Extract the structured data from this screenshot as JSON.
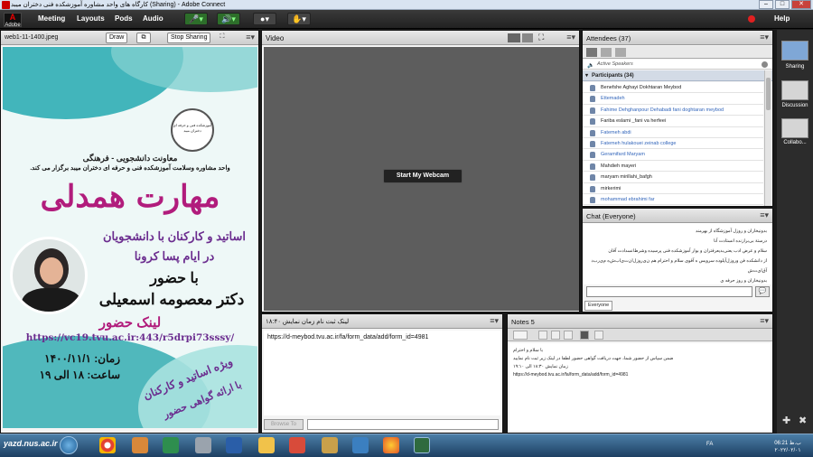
{
  "window_title": "کارگاه های  واحد مشاوره آموزشکده فنی دختران میبد (Sharing) - Adobe Connect",
  "app_logo_text": "Adobe",
  "menu": [
    "Meeting",
    "Layouts",
    "Pods",
    "Audio"
  ],
  "help_label": "Help",
  "share_pod": {
    "title": "web1-11-1400.jpeg",
    "draw_label": "Draw",
    "stop_label": "Stop Sharing",
    "poster": {
      "dept": "معاونت دانشجویی - فرهنگی",
      "org": "واحد مشاوره وسلامت آموزشکده فنی و حرفه ای دختران میبد برگزار می کند.",
      "main_title": "مهارت همدلی",
      "sub1": "اساتید و کارکنان با دانشجویان",
      "sub2": "در ایام پسا کرونا",
      "with": "با حضور",
      "speaker": "دکتر معصومه اسمعیلی",
      "link_title": "لینک حضور",
      "url": "https://vc19.tvu.ac.ir:443/r5drpi73sssy/",
      "date": "زمان: ۱۴۰۰/۱۱/۱",
      "time": "ساعت: ۱۸ الی ۱۹",
      "ribbon1": "ویژه اساتید و کارکنان",
      "ribbon2": "با ارائه گواهی حضور",
      "logo_text": "آموزشکده فنی و حرفه ای دختران میبد"
    }
  },
  "video_pod": {
    "title": "Video",
    "webcam_label": "Start My Webcam"
  },
  "attendees_pod": {
    "title": "Attendees",
    "count": "(37)",
    "active_speakers": "Active Speakers",
    "participants_header": "Participants (34)",
    "participants": [
      {
        "name": "Benefshe Aghayi Dokhtaran Meybod",
        "link": false
      },
      {
        "name": "Ettemadeh",
        "link": true
      },
      {
        "name": "Fahime Dehghanpour Dehabadi fani doghtaran meybod",
        "link": true
      },
      {
        "name": "Fariba eslami _fani va herfeei",
        "link": false
      },
      {
        "name": "Fatemeh abdi",
        "link": true
      },
      {
        "name": "Fatemeh hulakouei zeinab college",
        "link": true
      },
      {
        "name": "Geramifard Maryam",
        "link": true
      },
      {
        "name": "Mahdieh mayeri",
        "link": false
      },
      {
        "name": "maryam mirillahi_bafgh",
        "link": false
      },
      {
        "name": "mirkerimi",
        "link": false
      },
      {
        "name": "mohammad ebrahimi far",
        "link": true
      }
    ]
  },
  "chat_pod": {
    "title": "Chat",
    "scope": "(Everyone)",
    "messages": [
      "بدونیخاران و روزل آموزشگاه از بهرمند",
      "درستة ‌بی‌برازنده انستادت آنا",
      "سلام و عرض ادب یعنی‌بدیعرفتران و بوار آموزشکده فنی   پرسیده و‌شرط‌انسدادت آقان",
      "از دانشکده‌ فن و‌روزل‌آپلوده‌ سرویس‌ ه آقوی سلام و احترام‌ هم ‌ن‌ی‌روز‌ل‌ا‌ن‌ت‌ی‌ا‌ب‌ش‌ه‌ ‌م‌ی‌ر‌ب‌د‌ آ‌ق‌ا‌ی‌ت‌ش‌",
      "بدونیخاران و روز حرفه ی"
    ],
    "tab_label": "Everyone"
  },
  "link_pod": {
    "title": "لینک ثبت نام  زمان نمایش ۱۸:۴۰",
    "url": "https://d-meybod.tvu.ac.ir/fa/form_data/add/form_id=4981",
    "browse_label": "Browse To"
  },
  "notes_pod": {
    "title": "Notes 5",
    "lines": [
      "با سلام و احترام",
      "ضمن سپاس از حضور شما، جهت دریافت گواهی حضور لطفا در لینک زیر ثبت نام نمایید",
      "زمان نمایش ۱۸:۳۰ الی ۱۹:۱۰",
      "https://d-meybod.tvu.ac.ir/fa/form_data/add/form_id=4981"
    ]
  },
  "layouts": [
    {
      "label": "Sharing"
    },
    {
      "label": "Discussion"
    },
    {
      "label": "Collabo..."
    }
  ],
  "taskbar": {
    "watermark": "yazd.nus.ac.ir",
    "lang": "FA",
    "time": "06:21 ب.ظ",
    "date": "۲۰۲۲/۰۲/۰۱"
  },
  "colors": {
    "teal": "#1fa3a3",
    "poster_title": "#b11c7c",
    "poster_purple": "#6b2d8f",
    "chrome_dark": "#222222",
    "link_blue": "#3366bb"
  }
}
